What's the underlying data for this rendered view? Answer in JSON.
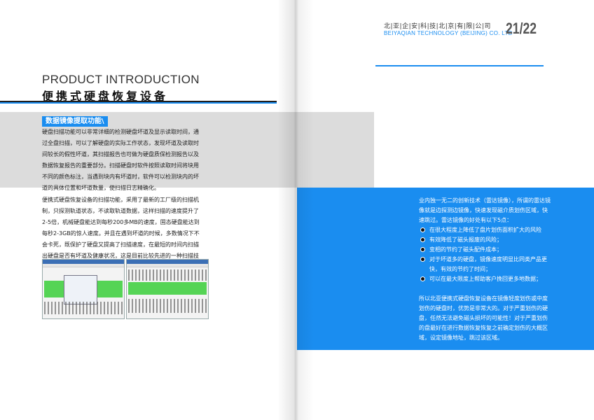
{
  "left_page": {
    "heading_en": "PRODUCT INTRODUCTION",
    "heading_cn": "便携式硬盘恢复设备",
    "section_label": "数据镜像提取功能\\",
    "paragraph_1": "硬盘扫描功能可以非常详细的检测硬盘坏道及显示读取时间，通过全盘扫描，可以了解硬盘的实际工作状态，发现坏道及读取时间较长的假性坏道，其扫描报告也可做为硬盘质保检测报告以及数据恢复报告的重要部分。扫描硬盘时软件按照读取时间将块用不同的颜色标注，当遇到块内有坏道时，软件可以检测块内的坏道的具体位置和坏道数量，使扫描日志精确化。",
    "paragraph_2": "便携式硬盘恢复设备的扫描功能，采用了最新的工厂级的扫描机制，只探测轨道状态，不读取轨道数据，这样扫描的速度提升了2-5倍，机械硬盘能达到每秒200多MB的速度，固态硬盘能达到每秒2-3GB的惊人速度。并且在遇到坏道的时候，多数情况下不会卡死，既保护了硬盘又提高了扫描速度，在最短的时间内扫描出硬盘是否有坏道及健康状况，这是目前比较先进的一种扫描技术",
    "screenshots": [
      "screenshot-scan-dialog",
      "screenshot-scan-map"
    ]
  },
  "right_page": {
    "company_cn": "北|亚|企|安|科|技|北|京|有|限|公|司",
    "company_en": "BEIYAQIAN TECHNOLOGY (BEIJING) CO. LTD",
    "page_number": "21/22",
    "intro": "业内独一无二的创新技术（雷达镜像），所谓的雷达镜像就是边探测边镜像，快速发现磁介质划伤区域，快速跳过。雷达镜像的好处有以下5点：",
    "bullets": [
      "在很大程度上降低了盘片划伤面积扩大的风险",
      "有效降低了磁头报废的风险；",
      "变相的节约了磁头配件成本；",
      "对于坏道多的硬盘，镜像速度明显比同类产品更快，有效的节约了时间；",
      "可以在最大限度上帮助客户挽回更多地数据；"
    ],
    "conclusion": "所以北亚便携式硬盘恢复设备在镜像轻度划伤或中度划伤的硬盘时，优势是非常大的。对于严重划伤的硬盘，任然无法避免磁头损坏的可能性！对于严重划伤的盘最好在进行数据恢复恢复之前确定划伤的大概区域，设定镜像地址，跳过该区域。"
  },
  "colors": {
    "accent_blue": "#1a8df0",
    "band_gray": "#dcdcdc"
  }
}
